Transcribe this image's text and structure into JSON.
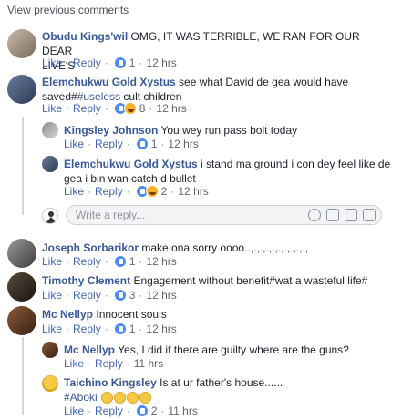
{
  "header": {
    "view_previous": "View previous comments"
  },
  "actions": {
    "like": "Like",
    "reply": "Reply"
  },
  "reply_box": {
    "placeholder": "Write a reply..."
  },
  "comments": [
    {
      "author": "Obudu Kings'wil",
      "text_line1": "OMG, IT WAS TERRIBLE, WE RAN FOR OUR DEAR",
      "text_line2": "LIVE'S",
      "reactions": "1",
      "time": "12 hrs"
    },
    {
      "author": "Elemchukwu Gold Xystus",
      "text_line1": "see what David de gea would have",
      "text_line2": "saved#",
      "hashtag": "#useless",
      "text_line2_rest": " cult children",
      "reactions": "8",
      "time": "12 hrs"
    },
    {
      "author": "Kingsley Johnson",
      "text_line1": "You wey run pass bolt today",
      "reactions": "1",
      "time": "12 hrs"
    },
    {
      "author": "Elemchukwu Gold Xystus",
      "text_line1": "i stand ma ground i con dey feel like de",
      "text_line2": "gea i bin wan catch d bullet",
      "reactions": "2",
      "time": "12 hrs"
    },
    {
      "author": "Joseph Sorbarikor",
      "text_line1": "make ona sorry oooo..,.,.,.,.,.,.,.,.,.,",
      "reactions": "1",
      "time": "12 hrs"
    },
    {
      "author": "Timothy Clement",
      "text_line1": "Engagement without benefit#wat a wasteful life#",
      "reactions": "3",
      "time": "12 hrs"
    },
    {
      "author": "Mc Nellyp",
      "text_line1": "Innocent souls",
      "reactions": "1",
      "time": "12 hrs"
    },
    {
      "author": "Mc Nellyp",
      "text_line1": "Yes, I did if there are guilty where are the guns?",
      "time": "11 hrs"
    },
    {
      "author": "Taichino Kingsley",
      "text_line1": "Is at ur father's house......",
      "text_line2": "#Aboki",
      "reactions": "2",
      "time": "11 hrs"
    }
  ]
}
